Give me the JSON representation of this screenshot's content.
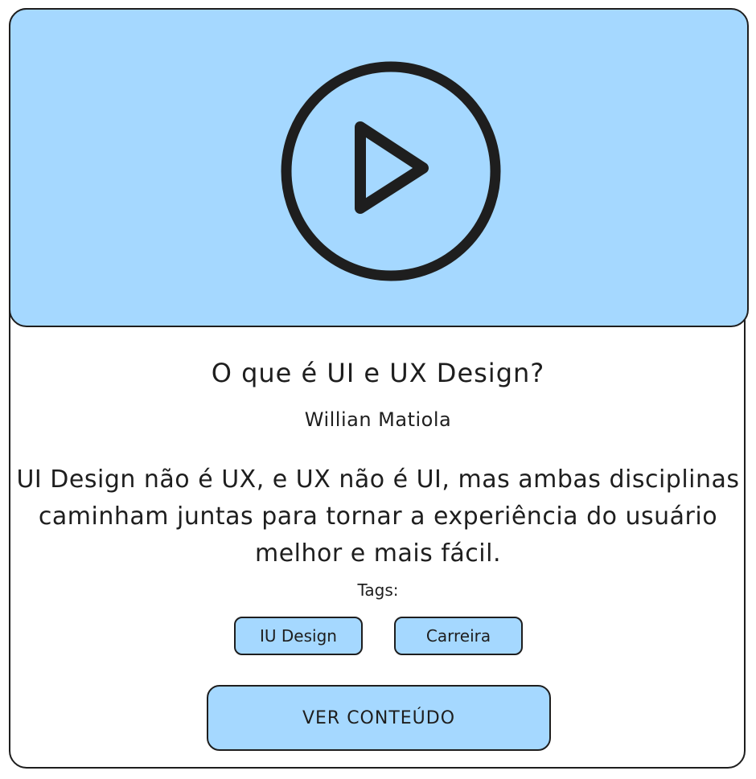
{
  "video": {
    "icon": "play-icon",
    "background_color": "#a5d8ff"
  },
  "content": {
    "title": "O que é UI e UX Design?",
    "author": "Willian Matiola",
    "description": "UI Design não é UX, e UX não é UI, mas ambas disciplinas caminham juntas para tornar  a experiência do usuário melhor e mais fácil."
  },
  "tags": {
    "label": "Tags:",
    "items": [
      {
        "label": "IU Design"
      },
      {
        "label": "Carreira"
      }
    ]
  },
  "cta": {
    "label": "VER CONTEÚDO"
  },
  "colors": {
    "accent": "#a5d8ff",
    "stroke": "#1e1e1e"
  }
}
